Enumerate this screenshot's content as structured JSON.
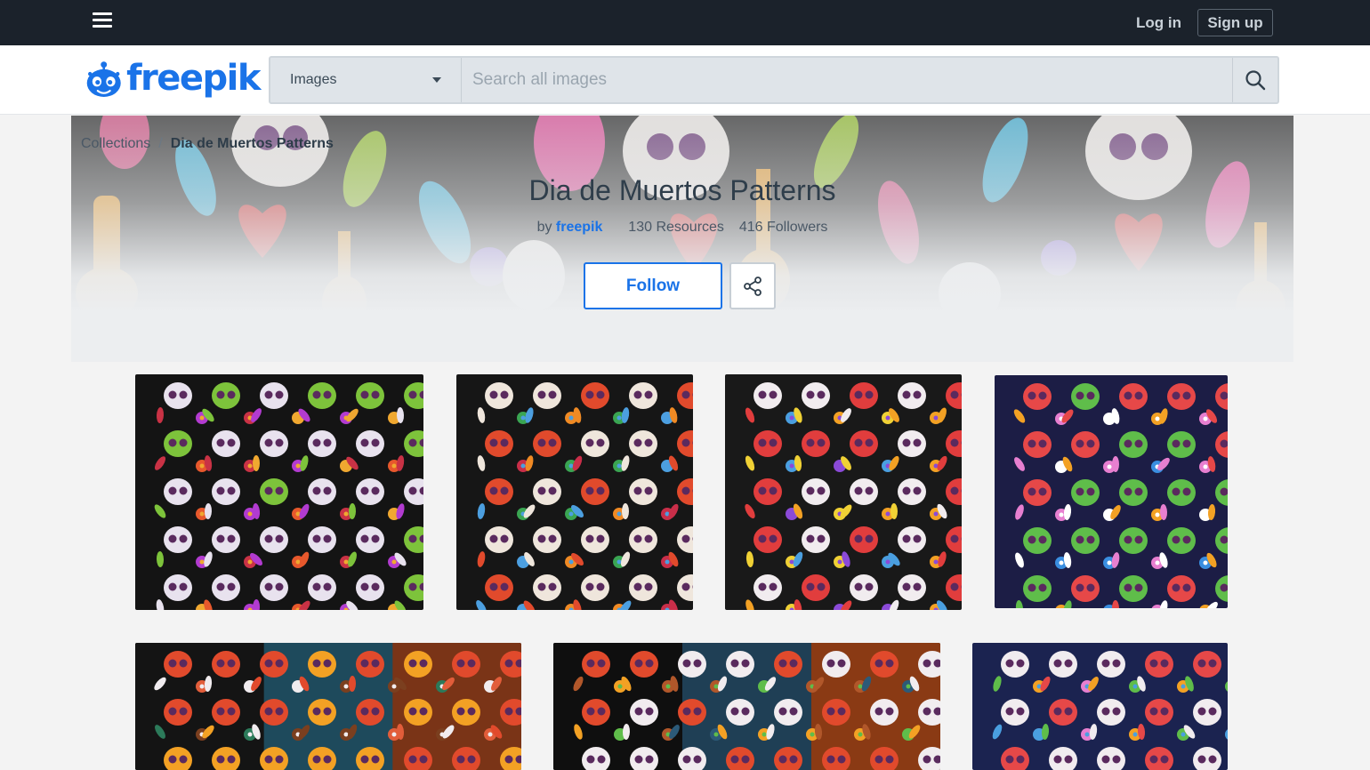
{
  "topbar": {
    "login_label": "Log in",
    "signup_label": "Sign up",
    "menu_icon": "hamburger-icon"
  },
  "header": {
    "logo_text": "freepik",
    "search_category": "Images",
    "search_placeholder": "Search all images",
    "search_icon": "search-icon"
  },
  "hero": {
    "breadcrumb_root": "Collections",
    "breadcrumb_sep": "/",
    "breadcrumb_current": "Dia de Muertos Patterns",
    "title": "Dia de Muertos Patterns",
    "by_label": "by",
    "author": "freepik",
    "resources": "130 Resources",
    "followers": "416 Followers",
    "follow_label": "Follow",
    "share_icon": "share-icon"
  },
  "colors": {
    "topbar_bg": "#1b222b",
    "brand_blue": "#1a73e8",
    "page_bg": "#f3f3f3"
  },
  "resources": [
    {
      "bg": "#141414",
      "accents": [
        "#e8e2ee",
        "#7dc33b",
        "#e7582c",
        "#f0a830",
        "#b23bd0",
        "#c93245"
      ]
    },
    {
      "bg": "#161616",
      "accents": [
        "#efe6dc",
        "#e14a2c",
        "#f08a24",
        "#4c9fe0",
        "#3aa552",
        "#c92e49"
      ]
    },
    {
      "bg": "#191919",
      "accents": [
        "#f1ecef",
        "#e13d3d",
        "#f3a124",
        "#8b4ad8",
        "#4a9fe0",
        "#f0d135"
      ]
    },
    {
      "bg": "#1c1d45",
      "accents": [
        "#5fbd4a",
        "#e64848",
        "#f3a124",
        "#ffffff",
        "#3a8ee0",
        "#e77fd0"
      ]
    },
    {
      "bg": "#1d1d1d",
      "accents": [
        "#f3a124",
        "#e14a2c",
        "#2c7a5a",
        "#f1ecef",
        "#7b3f1f",
        "#e25d3a"
      ]
    },
    {
      "bg": "#0f0f0f",
      "accents": [
        "#f1ecef",
        "#e14a2c",
        "#2c5a78",
        "#5fbd4a",
        "#b1572a",
        "#f3a124"
      ]
    },
    {
      "bg": "#1b2350",
      "accents": [
        "#f1ecef",
        "#e64848",
        "#f3a124",
        "#4a9fe0",
        "#e77fd0",
        "#5fbd4a"
      ]
    }
  ]
}
